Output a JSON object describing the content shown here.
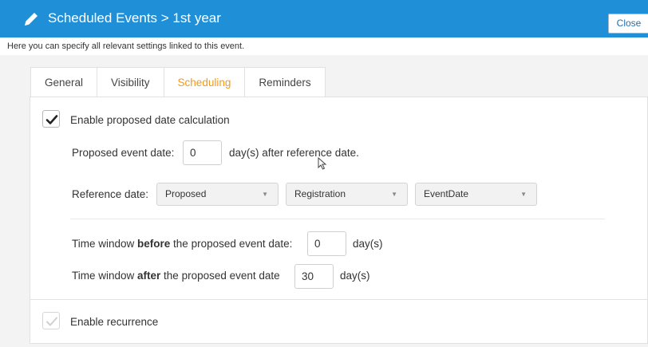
{
  "header": {
    "title": "Scheduled Events > 1st year",
    "close_label": "Close",
    "edit_icon": "pencil-icon"
  },
  "intro": "Here you can specify all relevant settings linked to this event.",
  "tabs": [
    {
      "label": "General",
      "active": false
    },
    {
      "label": "Visibility",
      "active": false
    },
    {
      "label": "Scheduling",
      "active": true
    },
    {
      "label": "Reminders",
      "active": false
    }
  ],
  "scheduling": {
    "enable_proposed": {
      "label": "Enable proposed date calculation",
      "checked": true
    },
    "proposed_event_date": {
      "label": "Proposed event date:",
      "value": "0",
      "suffix": "day(s) after reference date."
    },
    "reference_date": {
      "label": "Reference date:",
      "selects": [
        "Proposed",
        "Registration",
        "EventDate"
      ]
    },
    "time_before": {
      "prefix": "Time window ",
      "bold": "before",
      "suffix": " the proposed event date:",
      "value": "0",
      "unit": "day(s)"
    },
    "time_after": {
      "prefix": "Time window ",
      "bold": "after",
      "suffix": " the proposed event date",
      "value": "30",
      "unit": "day(s)"
    },
    "enable_recurrence": {
      "label": "Enable recurrence",
      "checked": false
    }
  },
  "colors": {
    "header": "#1f90d8",
    "active_tab": "#f29a1a"
  }
}
